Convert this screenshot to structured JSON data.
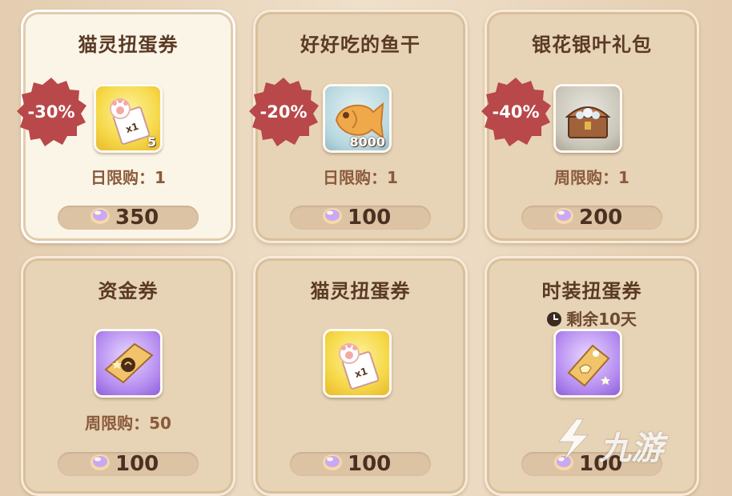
{
  "cards": [
    {
      "title": "猫灵扭蛋券",
      "discount": "-30%",
      "quantity": "5",
      "limit": "日限购：1",
      "price": "350",
      "icon": "cat-paw-ticket-icon"
    },
    {
      "title": "好好吃的鱼干",
      "discount": "-20%",
      "quantity": "8000",
      "limit": "日限购：1",
      "price": "100",
      "icon": "dried-fish-icon"
    },
    {
      "title": "银花银叶礼包",
      "discount": "-40%",
      "quantity": "",
      "limit": "周限购：1",
      "price": "200",
      "icon": "treasure-chest-icon"
    },
    {
      "title": "资金券",
      "discount": "",
      "quantity": "",
      "limit": "周限购：50",
      "price": "100",
      "icon": "fund-ticket-icon"
    },
    {
      "title": "猫灵扭蛋券",
      "discount": "",
      "quantity": "",
      "limit": "",
      "price": "100",
      "icon": "cat-paw-ticket-icon"
    },
    {
      "title": "时装扭蛋券",
      "discount": "",
      "quantity": "",
      "limit": "",
      "timer": "剩余10天",
      "price": "100",
      "icon": "costume-ticket-icon"
    }
  ],
  "currency_icon": "gem-icon",
  "watermark": "九游",
  "colors": {
    "title": "#5a3a24",
    "limit": "#8a5a3a",
    "discount_badge": "#b8484a",
    "price_bar": "#dcc3a4"
  }
}
